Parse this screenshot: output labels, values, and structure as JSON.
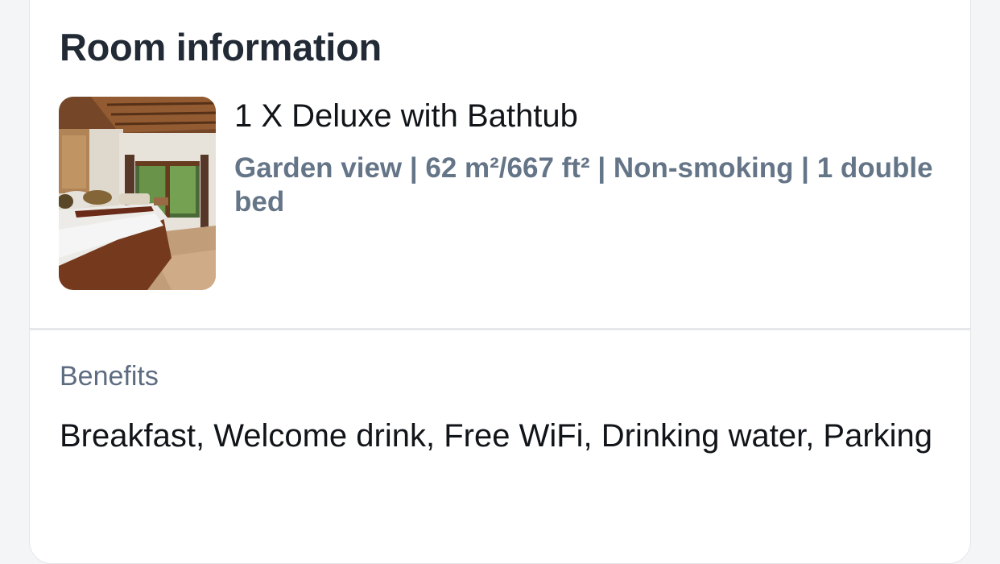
{
  "room_section": {
    "title": "Room information",
    "room_name": "1 X Deluxe with Bathtub",
    "room_details": "Garden view | 62 m²/667 ft² | Non-smoking | 1 double bed",
    "photo_icon": "room-photo"
  },
  "benefits_section": {
    "label": "Benefits",
    "text": "Breakfast, Welcome drink, Free WiFi, Drinking water, Parking"
  },
  "colors": {
    "card_background": "#ffffff",
    "title": "#222a35",
    "details": "#657588",
    "label": "#5d6c80",
    "body_text": "#111418",
    "divider": "#e6e8ec"
  }
}
